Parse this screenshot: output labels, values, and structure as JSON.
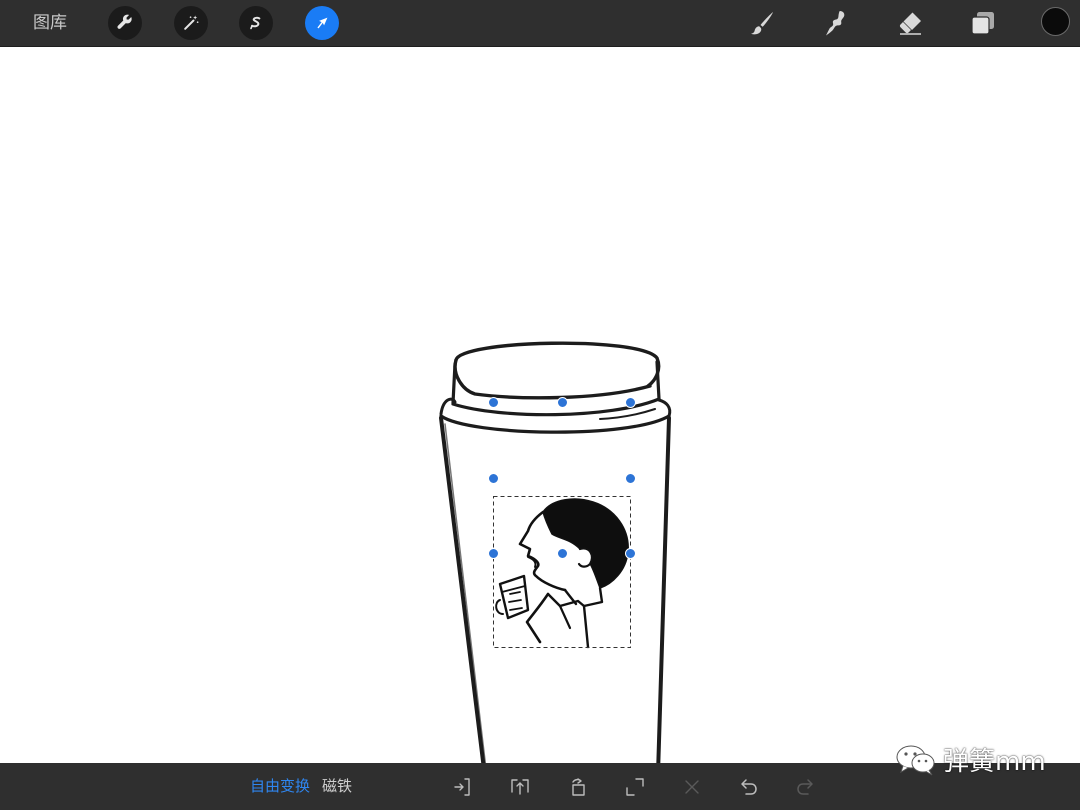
{
  "toolbar": {
    "gallery_label": "图库",
    "left_tools": [
      {
        "icon": "wrench-icon",
        "active": false
      },
      {
        "icon": "magic-wand-icon",
        "active": false
      },
      {
        "icon": "selection-s-icon",
        "active": false
      },
      {
        "icon": "transform-arrow-icon",
        "active": true
      }
    ],
    "right_tools": [
      "brush-icon",
      "smudge-icon",
      "eraser-icon",
      "layers-icon"
    ],
    "current_color": "#0b0b0b",
    "accent_color": "#1a7cf5"
  },
  "transform_bar": {
    "mode_free_label": "自由变换",
    "mode_magnet_label": "磁铁",
    "actions": [
      "flip-horizontal-icon",
      "flip-vertical-icon",
      "rotate-icon",
      "fit-to-screen-icon",
      "reset-icon",
      "undo-icon",
      "redo-icon"
    ]
  },
  "watermark": {
    "text": "弹簧mm",
    "icon": "wechat-icon"
  }
}
